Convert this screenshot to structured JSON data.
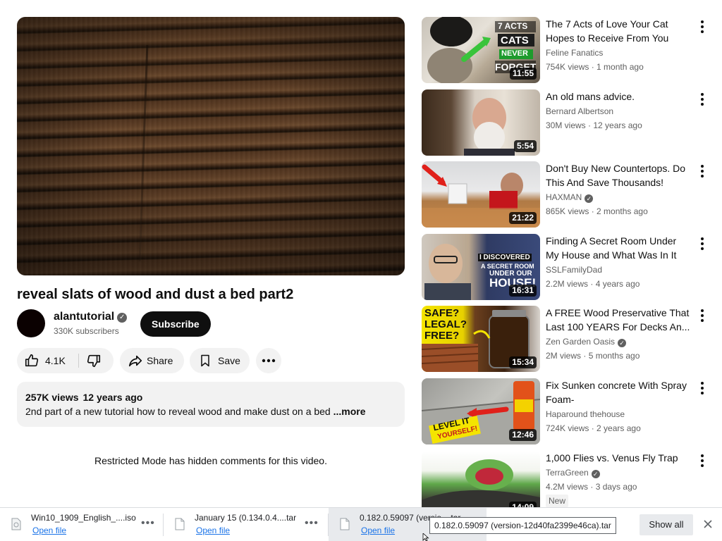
{
  "video": {
    "title": "reveal slats of wood and dust a bed part2",
    "channel_name": "alantutorial",
    "subscribers": "330K subscribers",
    "subscribe_label": "Subscribe",
    "likes": "4.1K",
    "share_label": "Share",
    "save_label": "Save",
    "views": "257K views",
    "age": "12 years ago",
    "description": "2nd part of a new tutorial how to reveal wood and make dust on a bed",
    "more_label": "...more",
    "restricted_notice": "Restricted Mode has hidden comments for this video."
  },
  "recommendations": [
    {
      "title": "The 7 Acts of Love Your Cat Hopes to Receive From You",
      "channel": "Feline Fanatics",
      "verified": false,
      "views": "754K views",
      "age": "1 month ago",
      "duration": "11:55",
      "thumb_text": [
        "7 ACTS",
        "CATS",
        "NEVER",
        "FORGET"
      ]
    },
    {
      "title": "An old mans advice.",
      "channel": "Bernard Albertson",
      "verified": false,
      "views": "30M views",
      "age": "12 years ago",
      "duration": "5:54"
    },
    {
      "title": "Don't Buy New Countertops. Do This And Save Thousands!",
      "channel": "HAXMAN",
      "verified": true,
      "views": "865K views",
      "age": "2 months ago",
      "duration": "21:22"
    },
    {
      "title": "Finding A Secret Room Under My House and What Was In It",
      "channel": "SSLFamilyDad",
      "verified": false,
      "views": "2.2M views",
      "age": "4 years ago",
      "duration": "16:31",
      "thumb_text": [
        "I DISCOVERED",
        "A SECRET ROOM",
        "UNDER OUR",
        "HOUSE!"
      ]
    },
    {
      "title": "A FREE Wood Preservative That Last 100 YEARS For Decks An...",
      "channel": "Zen Garden Oasis",
      "verified": true,
      "views": "2M views",
      "age": "5 months ago",
      "duration": "15:34",
      "thumb_text": [
        "SAFE?",
        "LEGAL?",
        "FREE?"
      ]
    },
    {
      "title": "Fix Sunken concrete With Spray Foam-",
      "channel": "Haparound thehouse",
      "verified": false,
      "views": "724K views",
      "age": "2 years ago",
      "duration": "12:46",
      "thumb_text": [
        "LEVEL IT",
        "YOURSELF!"
      ]
    },
    {
      "title": "1,000 Flies vs. Venus Fly Trap",
      "channel": "TerraGreen",
      "verified": true,
      "views": "4.2M views",
      "age": "3 days ago",
      "duration": "14:09",
      "badge": "New"
    }
  ],
  "downloads": {
    "items": [
      {
        "name": "Win10_1909_English_....iso",
        "open_label": "Open file"
      },
      {
        "name": "January 15 (0.134.0.4....tar",
        "open_label": "Open file"
      },
      {
        "name": "0.182.0.59097 (versio....tar",
        "open_label": "Open file"
      }
    ],
    "show_all_label": "Show all",
    "tooltip": "0.182.0.59097 (version-12d40fa2399e46ca).tar"
  }
}
